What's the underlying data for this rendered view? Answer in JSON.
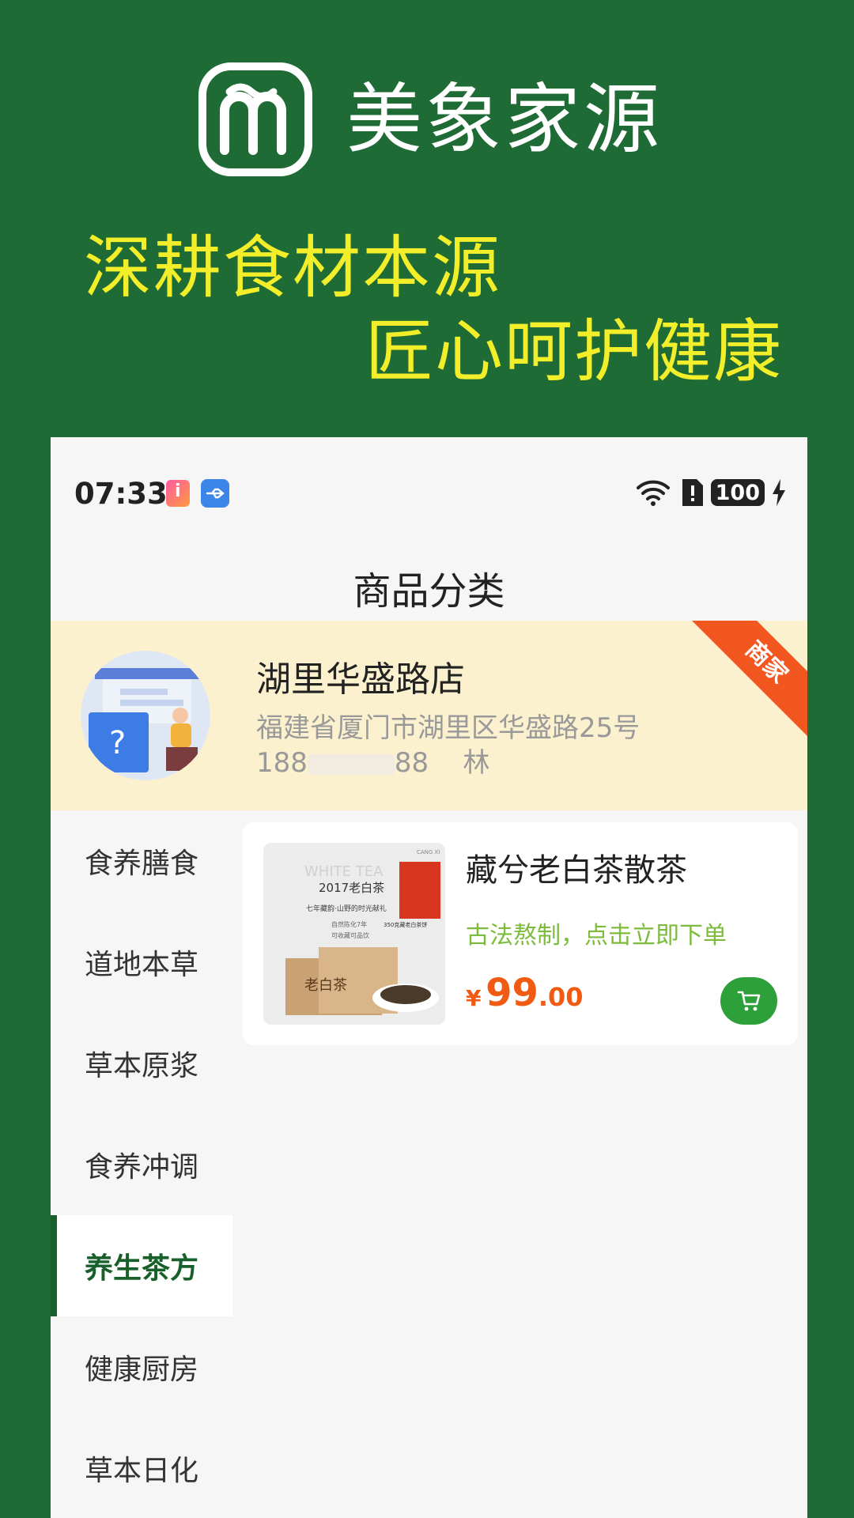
{
  "promo": {
    "brand_name": "美象家源",
    "slogan_line1": "深耕食材本源",
    "slogan_line2": "匠心呵护健康"
  },
  "statusbar": {
    "time": "07:33",
    "battery": "100"
  },
  "page": {
    "title": "商品分类"
  },
  "store": {
    "name": "湖里华盛路店",
    "address": "福建省厦门市湖里区华盛路25号",
    "phone_prefix": "188",
    "phone_suffix": "88",
    "contact": "林",
    "badge": "商家"
  },
  "categories": [
    {
      "label": "食养膳食",
      "active": false
    },
    {
      "label": "道地本草",
      "active": false
    },
    {
      "label": "草本原浆",
      "active": false
    },
    {
      "label": "食养冲调",
      "active": false
    },
    {
      "label": "养生茶方",
      "active": true
    },
    {
      "label": "健康厨房",
      "active": false
    },
    {
      "label": "草本日化",
      "active": false
    }
  ],
  "product": {
    "name": "藏兮老白茶散茶",
    "description": "古法熬制，点击立即下单",
    "currency": "¥",
    "price_int": "99",
    "price_dec": ".00",
    "image_text": {
      "brand": "CANG XI",
      "watermark": "WHITE TEA",
      "year": "2017老白茶",
      "line1": "七年藏韵·山野的时光献礼",
      "line2": "自然陈化7年",
      "line3": "可收藏可品饮",
      "pack": "老白茶",
      "side": "350克藏老白茶饼"
    }
  },
  "colors": {
    "brand_green": "#1e6b35",
    "slogan_yellow": "#f2ee2a",
    "active_green": "#17602a",
    "price_orange": "#f05a13",
    "desc_green": "#7dbb3c",
    "cart_green": "#2ea039",
    "ribbon_orange": "#f2571f"
  }
}
